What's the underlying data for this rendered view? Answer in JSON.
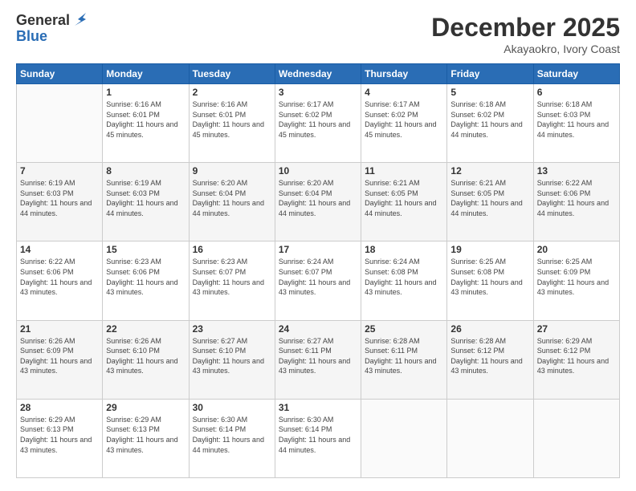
{
  "logo": {
    "general": "General",
    "blue": "Blue"
  },
  "header": {
    "month": "December 2025",
    "location": "Akayaokro, Ivory Coast"
  },
  "weekdays": [
    "Sunday",
    "Monday",
    "Tuesday",
    "Wednesday",
    "Thursday",
    "Friday",
    "Saturday"
  ],
  "weeks": [
    [
      {
        "day": "",
        "sunrise": "",
        "sunset": "",
        "daylight": ""
      },
      {
        "day": "1",
        "sunrise": "Sunrise: 6:16 AM",
        "sunset": "Sunset: 6:01 PM",
        "daylight": "Daylight: 11 hours and 45 minutes."
      },
      {
        "day": "2",
        "sunrise": "Sunrise: 6:16 AM",
        "sunset": "Sunset: 6:01 PM",
        "daylight": "Daylight: 11 hours and 45 minutes."
      },
      {
        "day": "3",
        "sunrise": "Sunrise: 6:17 AM",
        "sunset": "Sunset: 6:02 PM",
        "daylight": "Daylight: 11 hours and 45 minutes."
      },
      {
        "day": "4",
        "sunrise": "Sunrise: 6:17 AM",
        "sunset": "Sunset: 6:02 PM",
        "daylight": "Daylight: 11 hours and 45 minutes."
      },
      {
        "day": "5",
        "sunrise": "Sunrise: 6:18 AM",
        "sunset": "Sunset: 6:02 PM",
        "daylight": "Daylight: 11 hours and 44 minutes."
      },
      {
        "day": "6",
        "sunrise": "Sunrise: 6:18 AM",
        "sunset": "Sunset: 6:03 PM",
        "daylight": "Daylight: 11 hours and 44 minutes."
      }
    ],
    [
      {
        "day": "7",
        "sunrise": "Sunrise: 6:19 AM",
        "sunset": "Sunset: 6:03 PM",
        "daylight": "Daylight: 11 hours and 44 minutes."
      },
      {
        "day": "8",
        "sunrise": "Sunrise: 6:19 AM",
        "sunset": "Sunset: 6:03 PM",
        "daylight": "Daylight: 11 hours and 44 minutes."
      },
      {
        "day": "9",
        "sunrise": "Sunrise: 6:20 AM",
        "sunset": "Sunset: 6:04 PM",
        "daylight": "Daylight: 11 hours and 44 minutes."
      },
      {
        "day": "10",
        "sunrise": "Sunrise: 6:20 AM",
        "sunset": "Sunset: 6:04 PM",
        "daylight": "Daylight: 11 hours and 44 minutes."
      },
      {
        "day": "11",
        "sunrise": "Sunrise: 6:21 AM",
        "sunset": "Sunset: 6:05 PM",
        "daylight": "Daylight: 11 hours and 44 minutes."
      },
      {
        "day": "12",
        "sunrise": "Sunrise: 6:21 AM",
        "sunset": "Sunset: 6:05 PM",
        "daylight": "Daylight: 11 hours and 44 minutes."
      },
      {
        "day": "13",
        "sunrise": "Sunrise: 6:22 AM",
        "sunset": "Sunset: 6:06 PM",
        "daylight": "Daylight: 11 hours and 44 minutes."
      }
    ],
    [
      {
        "day": "14",
        "sunrise": "Sunrise: 6:22 AM",
        "sunset": "Sunset: 6:06 PM",
        "daylight": "Daylight: 11 hours and 43 minutes."
      },
      {
        "day": "15",
        "sunrise": "Sunrise: 6:23 AM",
        "sunset": "Sunset: 6:06 PM",
        "daylight": "Daylight: 11 hours and 43 minutes."
      },
      {
        "day": "16",
        "sunrise": "Sunrise: 6:23 AM",
        "sunset": "Sunset: 6:07 PM",
        "daylight": "Daylight: 11 hours and 43 minutes."
      },
      {
        "day": "17",
        "sunrise": "Sunrise: 6:24 AM",
        "sunset": "Sunset: 6:07 PM",
        "daylight": "Daylight: 11 hours and 43 minutes."
      },
      {
        "day": "18",
        "sunrise": "Sunrise: 6:24 AM",
        "sunset": "Sunset: 6:08 PM",
        "daylight": "Daylight: 11 hours and 43 minutes."
      },
      {
        "day": "19",
        "sunrise": "Sunrise: 6:25 AM",
        "sunset": "Sunset: 6:08 PM",
        "daylight": "Daylight: 11 hours and 43 minutes."
      },
      {
        "day": "20",
        "sunrise": "Sunrise: 6:25 AM",
        "sunset": "Sunset: 6:09 PM",
        "daylight": "Daylight: 11 hours and 43 minutes."
      }
    ],
    [
      {
        "day": "21",
        "sunrise": "Sunrise: 6:26 AM",
        "sunset": "Sunset: 6:09 PM",
        "daylight": "Daylight: 11 hours and 43 minutes."
      },
      {
        "day": "22",
        "sunrise": "Sunrise: 6:26 AM",
        "sunset": "Sunset: 6:10 PM",
        "daylight": "Daylight: 11 hours and 43 minutes."
      },
      {
        "day": "23",
        "sunrise": "Sunrise: 6:27 AM",
        "sunset": "Sunset: 6:10 PM",
        "daylight": "Daylight: 11 hours and 43 minutes."
      },
      {
        "day": "24",
        "sunrise": "Sunrise: 6:27 AM",
        "sunset": "Sunset: 6:11 PM",
        "daylight": "Daylight: 11 hours and 43 minutes."
      },
      {
        "day": "25",
        "sunrise": "Sunrise: 6:28 AM",
        "sunset": "Sunset: 6:11 PM",
        "daylight": "Daylight: 11 hours and 43 minutes."
      },
      {
        "day": "26",
        "sunrise": "Sunrise: 6:28 AM",
        "sunset": "Sunset: 6:12 PM",
        "daylight": "Daylight: 11 hours and 43 minutes."
      },
      {
        "day": "27",
        "sunrise": "Sunrise: 6:29 AM",
        "sunset": "Sunset: 6:12 PM",
        "daylight": "Daylight: 11 hours and 43 minutes."
      }
    ],
    [
      {
        "day": "28",
        "sunrise": "Sunrise: 6:29 AM",
        "sunset": "Sunset: 6:13 PM",
        "daylight": "Daylight: 11 hours and 43 minutes."
      },
      {
        "day": "29",
        "sunrise": "Sunrise: 6:29 AM",
        "sunset": "Sunset: 6:13 PM",
        "daylight": "Daylight: 11 hours and 43 minutes."
      },
      {
        "day": "30",
        "sunrise": "Sunrise: 6:30 AM",
        "sunset": "Sunset: 6:14 PM",
        "daylight": "Daylight: 11 hours and 44 minutes."
      },
      {
        "day": "31",
        "sunrise": "Sunrise: 6:30 AM",
        "sunset": "Sunset: 6:14 PM",
        "daylight": "Daylight: 11 hours and 44 minutes."
      },
      {
        "day": "",
        "sunrise": "",
        "sunset": "",
        "daylight": ""
      },
      {
        "day": "",
        "sunrise": "",
        "sunset": "",
        "daylight": ""
      },
      {
        "day": "",
        "sunrise": "",
        "sunset": "",
        "daylight": ""
      }
    ]
  ]
}
